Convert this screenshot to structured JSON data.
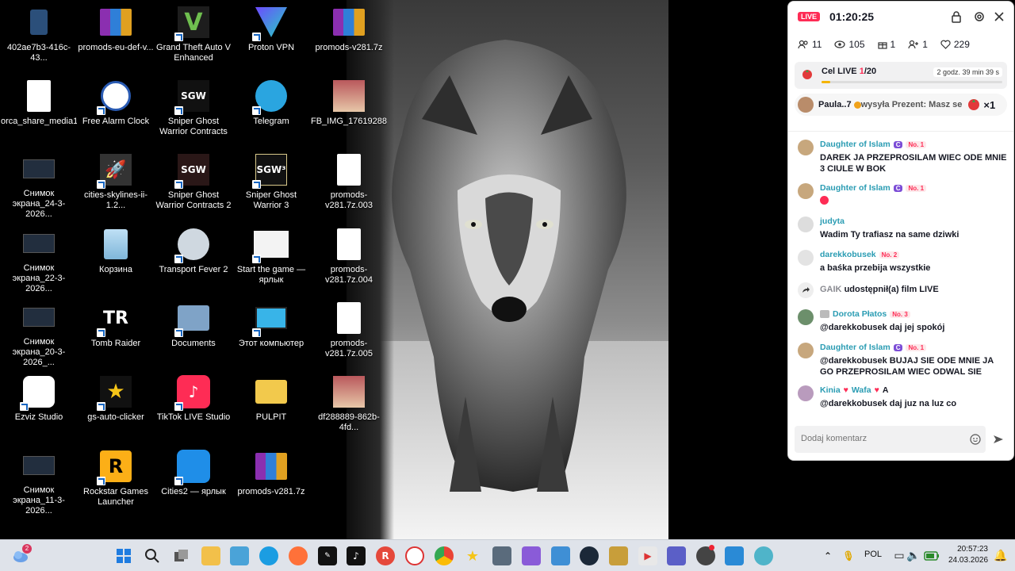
{
  "desktop": {
    "icons": [
      {
        "label": "402ae7b3-416c-43...",
        "icon": "phone-image-icon"
      },
      {
        "label": "promods-eu-def-v...",
        "icon": "winrar-archive-icon"
      },
      {
        "label": "Grand Theft Auto V Enhanced",
        "icon": "gta5-icon"
      },
      {
        "label": "Proton VPN",
        "icon": "proton-vpn-icon"
      },
      {
        "label": "promods-v281.7z",
        "icon": "winrar-archive-icon"
      },
      {
        "label": "orca_share_media1...",
        "icon": "blank-file-icon"
      },
      {
        "label": "Free Alarm Clock",
        "icon": "alarm-clock-icon"
      },
      {
        "label": "Sniper Ghost Warrior Contracts",
        "icon": "sgw-contracts-icon"
      },
      {
        "label": "Telegram",
        "icon": "telegram-icon"
      },
      {
        "label": "FB_IMG_176192880...",
        "icon": "photo-icon"
      },
      {
        "label": "Снимок экрана_24-3-2026...",
        "icon": "screenshot-thumbnail-icon"
      },
      {
        "label": "cities-skylines-ii-1.2...",
        "icon": "rocket-setup-icon"
      },
      {
        "label": "Sniper Ghost Warrior Contracts 2",
        "icon": "sgw-contracts2-icon"
      },
      {
        "label": "Sniper Ghost Warrior 3",
        "icon": "sgw3-icon"
      },
      {
        "label": "promods-v281.7z.003",
        "icon": "blank-file-icon"
      },
      {
        "label": "Снимок экрана_22-3-2026...",
        "icon": "screenshot-thumbnail-icon"
      },
      {
        "label": "Корзина",
        "icon": "recycle-bin-icon"
      },
      {
        "label": "Transport Fever 2",
        "icon": "transport-fever-icon"
      },
      {
        "label": "Start the game — ярлык",
        "icon": "settings-file-icon"
      },
      {
        "label": "promods-v281.7z.004",
        "icon": "blank-file-icon"
      },
      {
        "label": "Снимок экрана_20-3-2026_...",
        "icon": "screenshot-thumbnail-icon"
      },
      {
        "label": "Tomb Raider",
        "icon": "tomb-raider-icon"
      },
      {
        "label": "Documents",
        "icon": "documents-folder-icon"
      },
      {
        "label": "Этот компьютер",
        "icon": "this-pc-icon"
      },
      {
        "label": "promods-v281.7z.005",
        "icon": "blank-file-icon"
      },
      {
        "label": "Ezviz Studio",
        "icon": "ezviz-icon"
      },
      {
        "label": "gs-auto-clicker",
        "icon": "star-clicker-icon"
      },
      {
        "label": "TikTok LIVE Studio",
        "icon": "tiktok-live-studio-icon"
      },
      {
        "label": "PULPIT",
        "icon": "folder-icon"
      },
      {
        "label": "df288889-862b-4fd...",
        "icon": "photo-icon"
      },
      {
        "label": "Снимок экрана_11-3-2026...",
        "icon": "screenshot-thumbnail-icon"
      },
      {
        "label": "Rockstar Games Launcher",
        "icon": "rockstar-icon"
      },
      {
        "label": "Cities2 — ярлык",
        "icon": "cities2-icon"
      },
      {
        "label": "promods-v281.7z",
        "icon": "winrar-archive-icon"
      }
    ]
  },
  "live": {
    "badge": "LIVE",
    "timer": "01:20:25",
    "stats": {
      "viewers_members": "11",
      "views": "105",
      "gifts": "1",
      "follows": "1",
      "likes": "229"
    },
    "goal": {
      "label": "Cel LIVE ",
      "current": "1",
      "total": "/20",
      "remaining": "2 godz. 39 min 39 s",
      "progress": 0.05
    },
    "gift_banner": {
      "user": "Paula..7",
      "text": " wysyła Prezent: Masz se",
      "count": "×1"
    },
    "messages": [
      {
        "user": "Daughter of Islam",
        "badge_c": "C",
        "rank": "No. 1",
        "text": "DAREK JA PRZEPROSILAM WIEC ODE MNIE 3 CIULE W BOK"
      },
      {
        "user": "Daughter of Islam",
        "badge_c": "C",
        "rank": "No. 1",
        "text": ""
      },
      {
        "user": "judyta",
        "badge_c": "",
        "rank": "",
        "text": "Wadim Ty trafiasz na same dziwki"
      },
      {
        "user": "darekkobusek",
        "badge_c": "",
        "rank": "No. 2",
        "text": "a baśka przebija wszystkie"
      },
      {
        "user": "Dorota Płatos",
        "badge_c": "",
        "rank": "No. 3",
        "text": "@darekkobusek daj jej spokój"
      },
      {
        "user": "Daughter of Islam",
        "badge_c": "C",
        "rank": "No. 1",
        "text": "@darekkobusek BUJAJ SIE ODE MNIE JA GO PRZEPROSILAM WIEC ODWAL SIE"
      },
      {
        "user": "Kinia",
        "badge_c": "",
        "rank": "",
        "text": "@darekkobusek daj juz na luz co",
        "extra": "Wafa",
        "extra2": "A"
      }
    ],
    "share_event": {
      "user": "GAIK",
      "text": "udostępnił(a) film LIVE"
    },
    "comment_placeholder": "Dodaj komentarz"
  },
  "taskbar": {
    "notification_count": "2",
    "language": "POL",
    "time": "20:57:23",
    "date": "24.03.2026"
  }
}
